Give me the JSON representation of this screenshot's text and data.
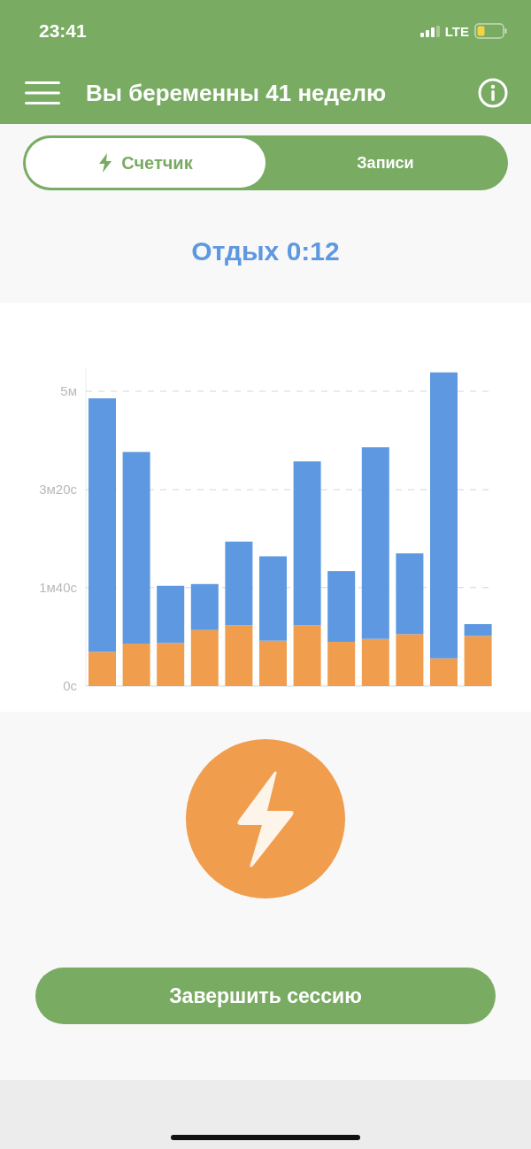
{
  "status_bar": {
    "time": "23:41",
    "network": "LTE"
  },
  "header": {
    "title": "Вы беременны 41 неделю"
  },
  "tabs": [
    {
      "label": "Счетчик",
      "selected": true
    },
    {
      "label": "Записи",
      "selected": false
    }
  ],
  "status_text": "Отдых 0:12",
  "chart_data": {
    "type": "bar",
    "stacked": true,
    "grid": true,
    "ylim": [
      0,
      5.4
    ],
    "yticks": [
      {
        "value": 0,
        "label": "0с"
      },
      {
        "value": 1.67,
        "label": "1м40с"
      },
      {
        "value": 3.33,
        "label": "3м20с"
      },
      {
        "value": 5,
        "label": "5м"
      }
    ],
    "series": [
      {
        "color": "#f09d4d",
        "values": [
          0.58,
          0.72,
          0.73,
          0.95,
          1.03,
          0.77,
          1.03,
          0.75,
          0.8,
          0.88,
          0.47,
          0.85
        ]
      },
      {
        "color": "#5d98e0",
        "values": [
          4.3,
          3.25,
          0.97,
          0.78,
          1.42,
          1.43,
          2.78,
          1.2,
          3.25,
          1.37,
          4.85,
          0.2
        ]
      }
    ]
  },
  "end_button": {
    "label": "Завершить сессию"
  }
}
